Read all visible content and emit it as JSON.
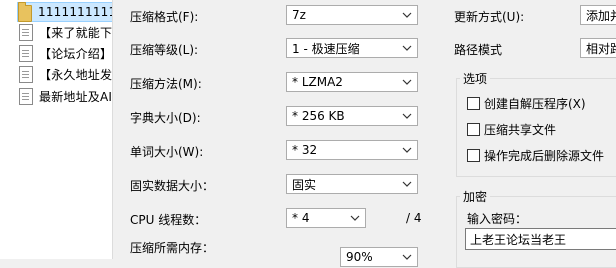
{
  "files": [
    {
      "name": "1111111111",
      "type": "folder"
    },
    {
      "name": "【来了就能下",
      "type": "doc"
    },
    {
      "name": "【论坛介绍】",
      "type": "doc"
    },
    {
      "name": "【永久地址发",
      "type": "doc"
    },
    {
      "name": "最新地址及AI",
      "type": "doc"
    }
  ],
  "form": {
    "format_label": "压缩格式(F):",
    "format_value": "7z",
    "level_label": "压缩等级(L):",
    "level_value": "1 - 极速压缩",
    "method_label": "压缩方法(M):",
    "method_value": "* LZMA2",
    "dict_label": "字典大小(D):",
    "dict_value": "* 256 KB",
    "word_label": "单词大小(W):",
    "word_value": "* 32",
    "solid_label": "固实数据大小：",
    "solid_value": "固实",
    "threads_label": "CPU 线程数：",
    "threads_value": "* 4",
    "threads_total": "/ 4",
    "memory_label": "压缩所需内存：",
    "memory_value": "90%"
  },
  "right": {
    "update_label": "更新方式(U):",
    "update_value": "添加并",
    "path_label": "路径模式",
    "path_value": "相对路",
    "options_title": "选项",
    "opt_sfx": "创建自解压程序(X)",
    "opt_shared": "压缩共享文件",
    "opt_delete": "操作完成后删除源文件",
    "encrypt_title": "加密",
    "password_label": "输入密码：",
    "password_value": "上老王论坛当老王"
  }
}
